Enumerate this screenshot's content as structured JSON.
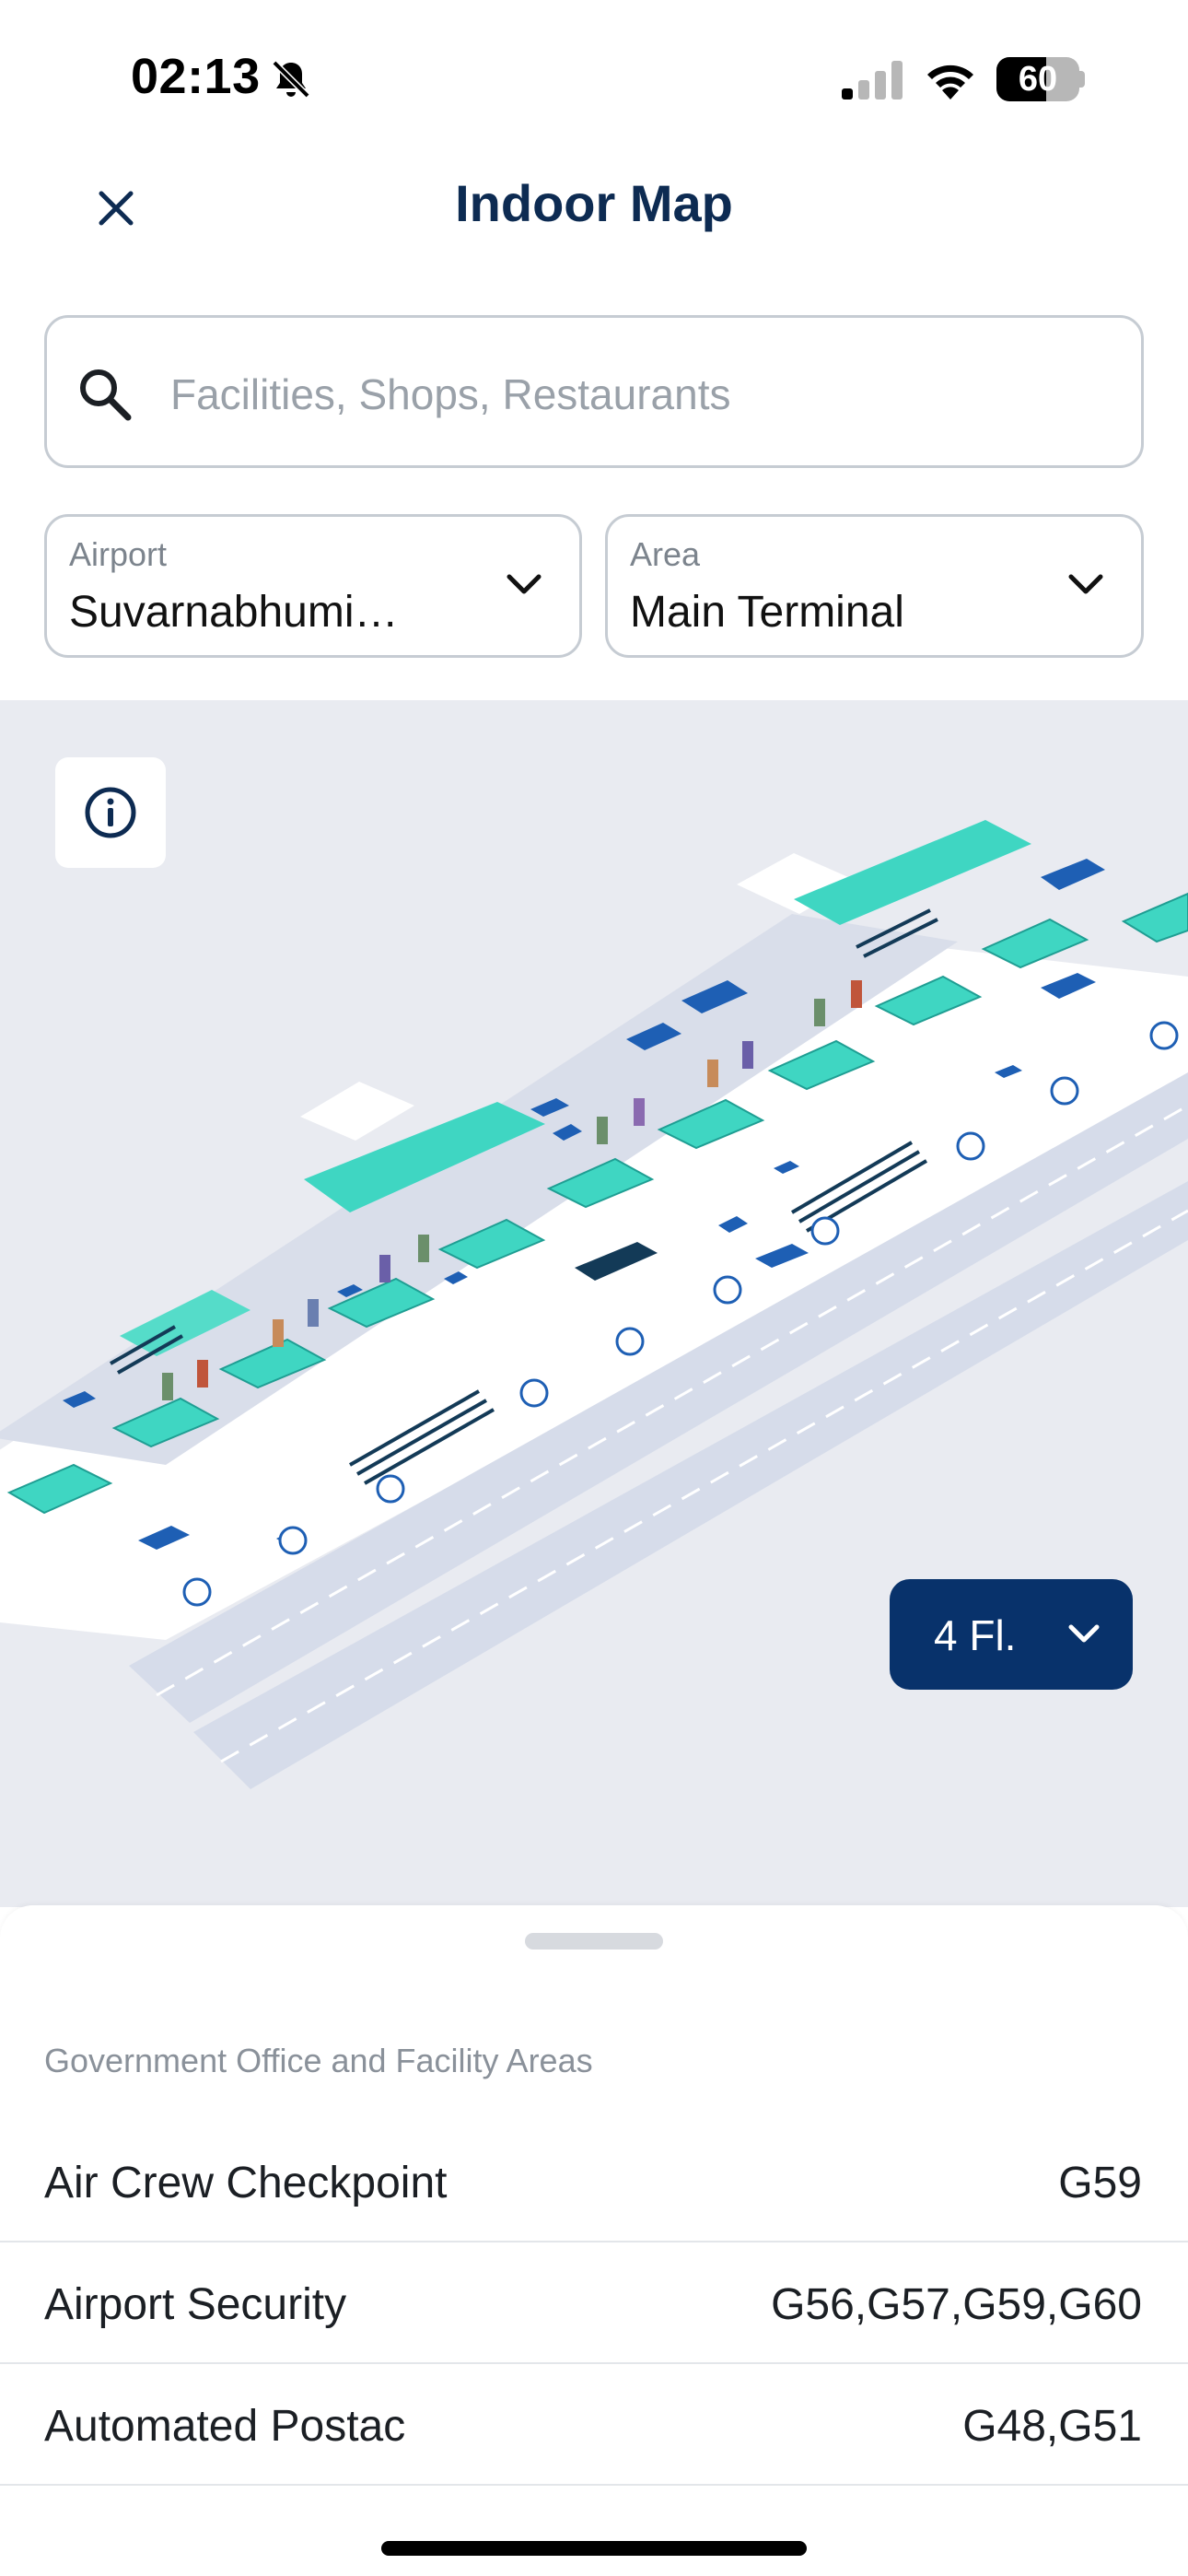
{
  "status_bar": {
    "time": "02:13",
    "battery_level": "60",
    "battery_fraction": 0.6,
    "icons": [
      "bell-slash-icon",
      "signal-icon",
      "wifi-icon",
      "battery-icon"
    ]
  },
  "header": {
    "title": "Indoor Map",
    "close_icon": "close-icon"
  },
  "search": {
    "placeholder": "Facilities, Shops, Restaurants",
    "value": "",
    "icon": "search-icon"
  },
  "filters": {
    "airport": {
      "label": "Airport",
      "value": "Suvarnabhumi…"
    },
    "area": {
      "label": "Area",
      "value": "Main Terminal"
    }
  },
  "map": {
    "info_icon": "info-icon",
    "floor": "4 Fl.",
    "colors": {
      "background": "#e9ebf1",
      "floor": "#ffffff",
      "teal_block": "#3fd6c2",
      "blue_block": "#1e5fb4",
      "navy": "#08326b",
      "runway": "#d5dbe8"
    }
  },
  "sheet": {
    "section_title": "Government Office and Facility Areas",
    "items": [
      {
        "name": "Air Crew Checkpoint",
        "gates": "G59"
      },
      {
        "name": "Airport Security",
        "gates": "G56,G57,G59,G60"
      },
      {
        "name": "Automated Postac",
        "gates": "G48,G51"
      }
    ]
  }
}
